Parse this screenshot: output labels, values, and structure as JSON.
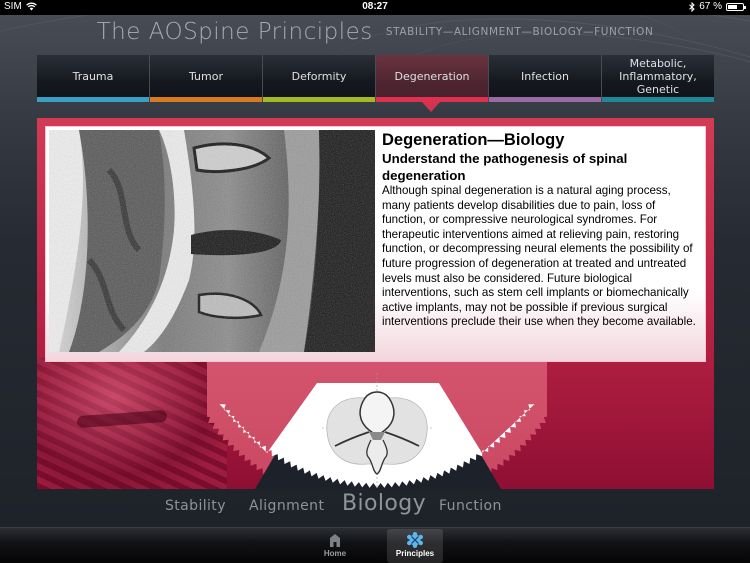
{
  "status_bar": {
    "carrier": "SIM",
    "time": "08:27",
    "battery_percent_label": "67 %",
    "battery_level": 0.67,
    "icons": [
      "wifi-icon",
      "bluetooth-icon",
      "battery-icon"
    ]
  },
  "header": {
    "title": "The AOSpine Principles",
    "subtitle": "STABILITY—ALIGNMENT—BIOLOGY—FUNCTION"
  },
  "categories": [
    {
      "label": "Trauma",
      "color": "#3b9fc4",
      "active": false
    },
    {
      "label": "Tumor",
      "color": "#d97a1f",
      "active": false
    },
    {
      "label": "Deformity",
      "color": "#a5ba1e",
      "active": false
    },
    {
      "label": "Degeneration",
      "color": "#e0304f",
      "active": true
    },
    {
      "label": "Infection",
      "color": "#9a6aa3",
      "active": false
    },
    {
      "label": "Metabolic,\nInflammatory,\nGenetic",
      "color": "#1c8a96",
      "active": false
    }
  ],
  "content": {
    "image_alt": "Sagittal MRI of lumbar spine showing disc degeneration",
    "title": "Degeneration—Biology",
    "subtitle": "Understand the pathogenesis of spinal degeneration",
    "body": "Although spinal degeneration is a natural aging process, many patients develop disabilities due to pain, loss of function, or compressive neurological syndromes. For therapeutic interventions aimed at relieving pain, restoring function, or decompressing neural elements the possibility of future progression of degeneration at treated and untreated levels must also be considered. Future biological interventions, such as stem cell implants or biomechanically active implants, may not be possible if previous surgical interventions preclude their use when they become available.",
    "accent_color": "#c8284a"
  },
  "principles": [
    {
      "label": "Stability",
      "active": false
    },
    {
      "label": "Alignment",
      "active": false
    },
    {
      "label": "Biology",
      "active": true
    },
    {
      "label": "Function",
      "active": false
    }
  ],
  "tab_bar": [
    {
      "label": "Home",
      "icon": "home-icon",
      "active": false
    },
    {
      "label": "Principles",
      "icon": "principles-icon",
      "active": true
    }
  ]
}
